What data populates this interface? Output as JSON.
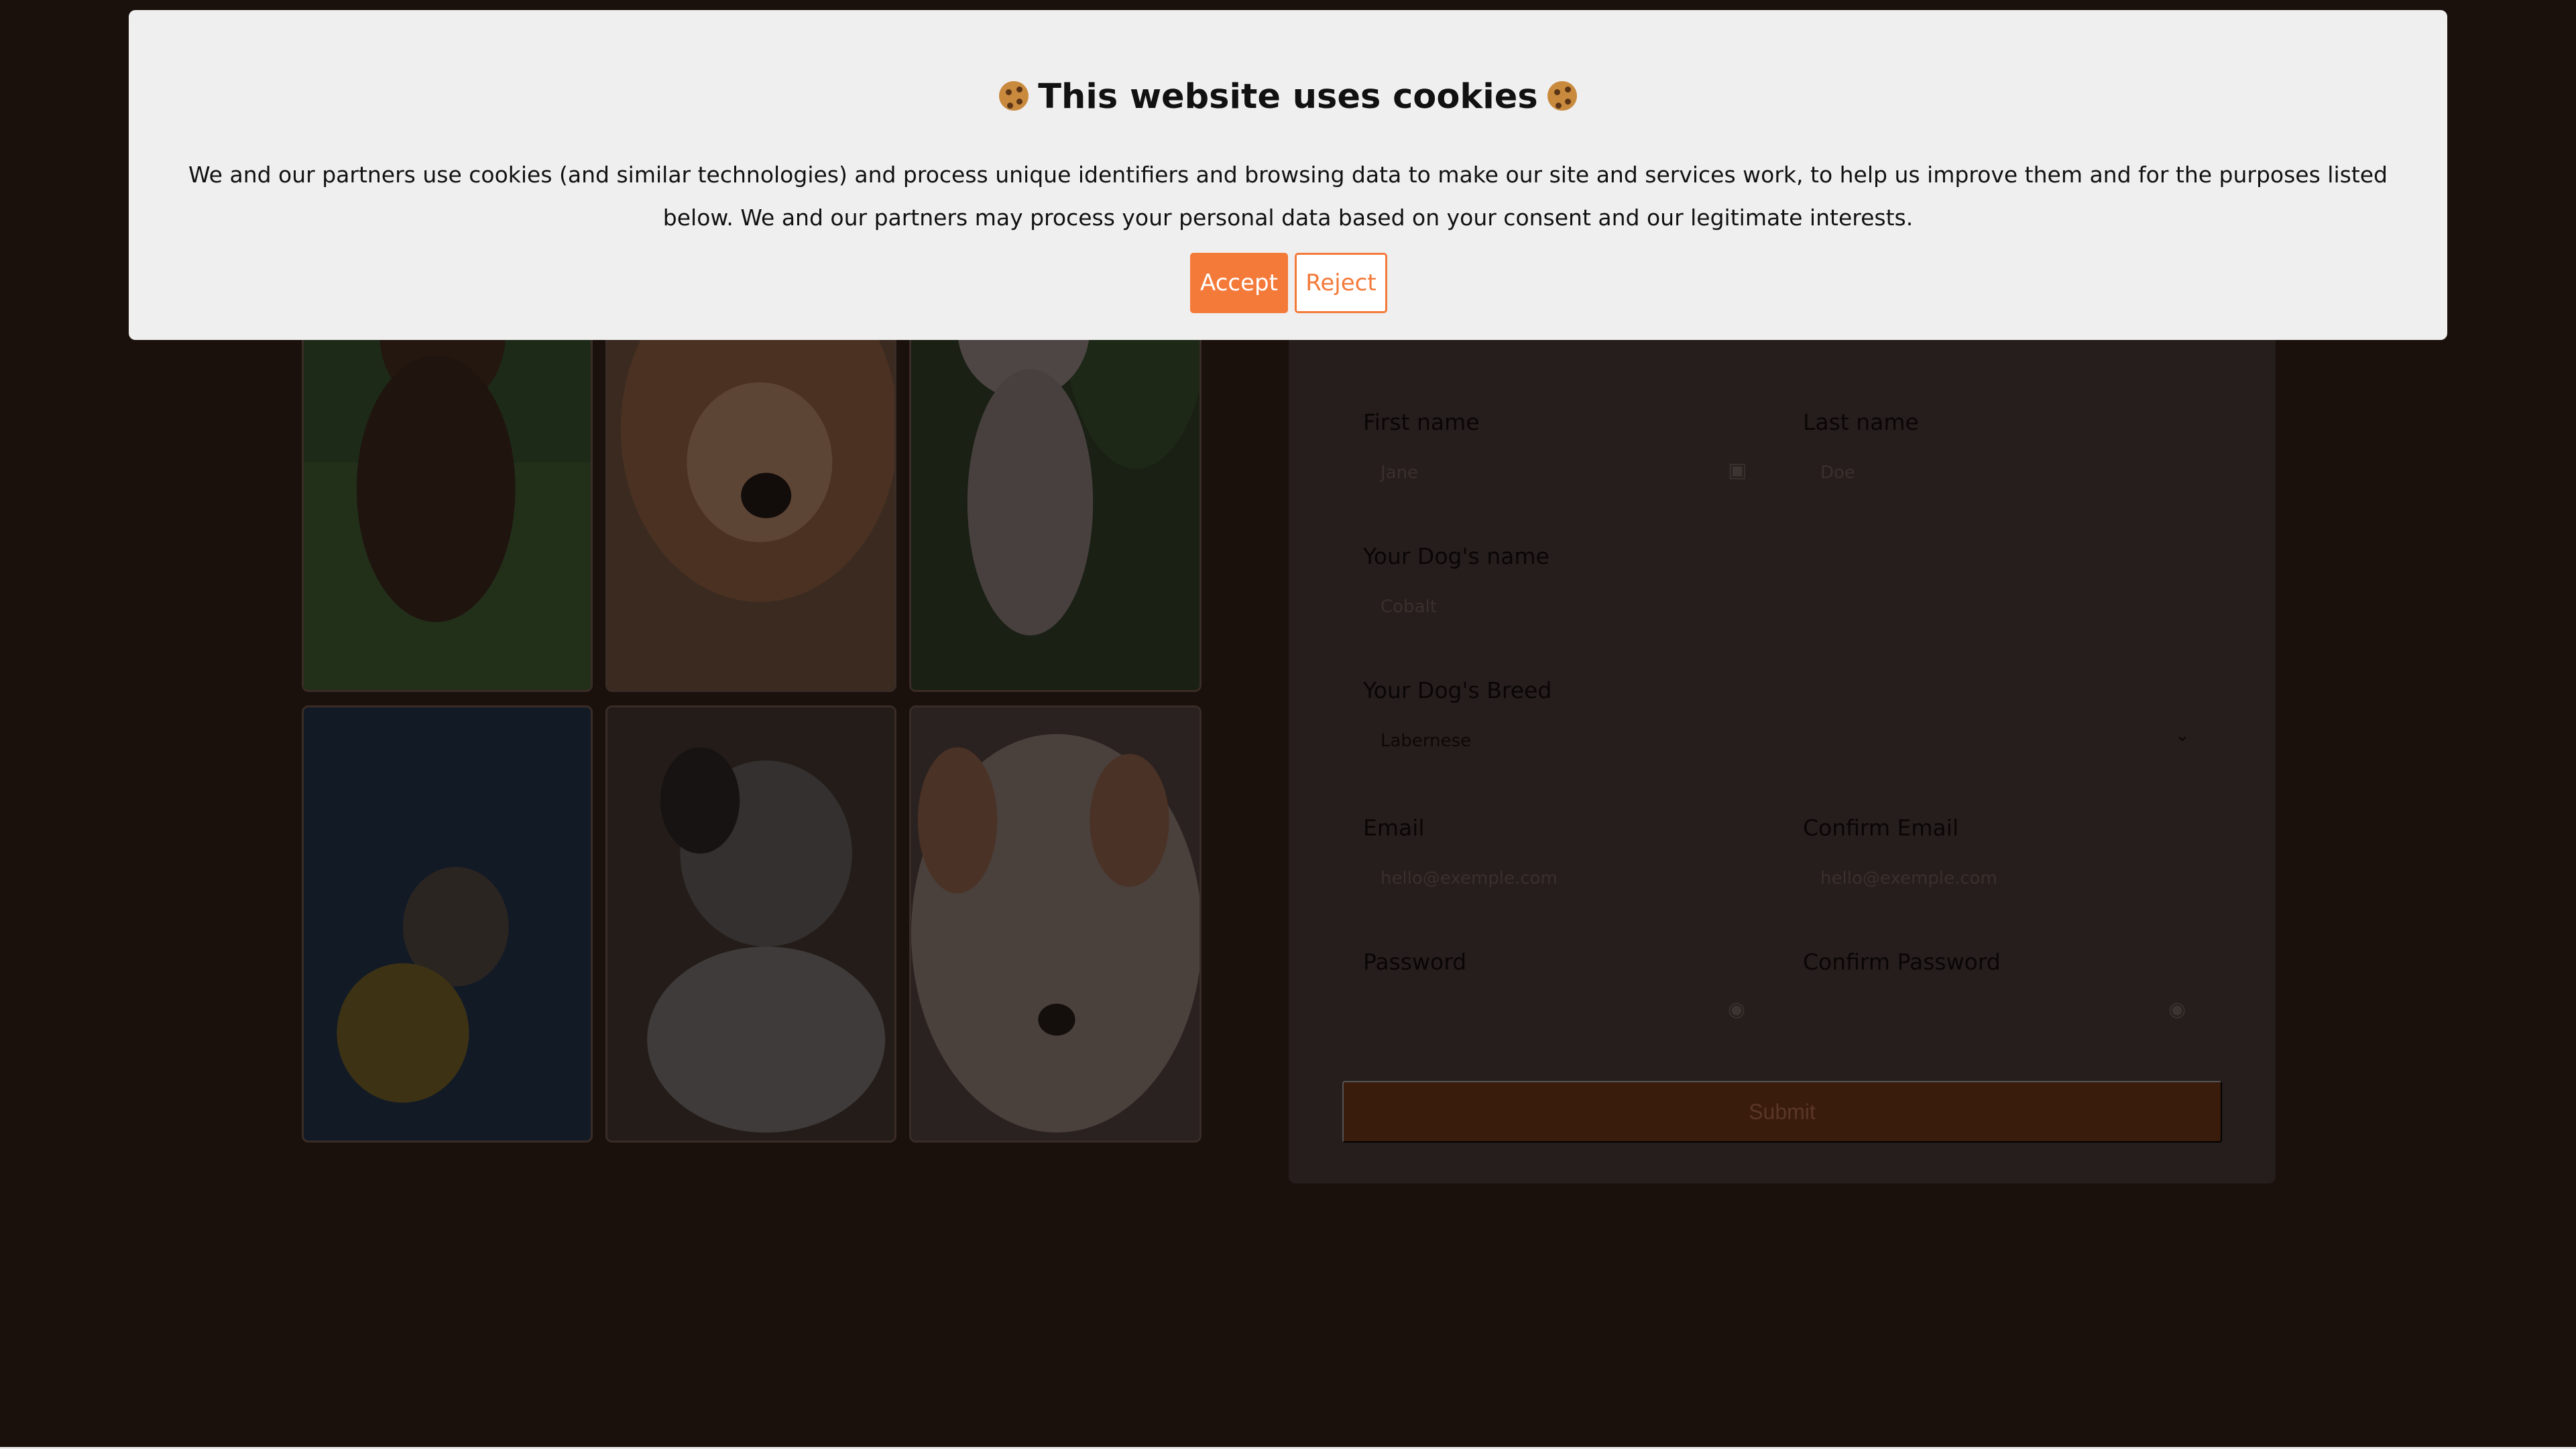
{
  "cookie_banner": {
    "title": "This website uses cookies",
    "text": "We and our partners use cookies (and similar technologies) and process unique identifiers and browsing data to make our site and services work, to help us improve them and for the purposes listed below. We and our partners may process your personal data based on your consent and our legitimate interests.",
    "accept_label": "Accept",
    "reject_label": "Reject"
  },
  "form": {
    "first_name": {
      "label": "First name",
      "placeholder": "Jane"
    },
    "last_name": {
      "label": "Last name",
      "placeholder": "Doe"
    },
    "dog_name": {
      "label": "Your Dog's name",
      "placeholder": "Cobalt"
    },
    "dog_breed": {
      "label": "Your Dog's Breed",
      "value": "Labernese"
    },
    "email": {
      "label": "Email",
      "placeholder": "hello@exemple.com"
    },
    "confirm_email": {
      "label": "Confirm Email",
      "placeholder": "hello@exemple.com"
    },
    "password": {
      "label": "Password"
    },
    "confirm_password": {
      "label": "Confirm Password"
    },
    "submit_label": "Submit"
  },
  "gallery": {
    "photos": [
      "chocolate-labrador-puppy",
      "fluffy-sable-puppy",
      "jack-russell-puppy",
      "french-bulldog-yellow-hoodie",
      "australian-shepherd-puppy",
      "white-puppy-closeup"
    ]
  },
  "colors": {
    "accent": "#f47a3a",
    "page_background": "#1a100c",
    "form_background": "#251e1c",
    "banner_background": "#efefef"
  },
  "icons": [
    "cookie-icon",
    "contact-card-icon",
    "chevron-down-icon",
    "eye-icon"
  ]
}
